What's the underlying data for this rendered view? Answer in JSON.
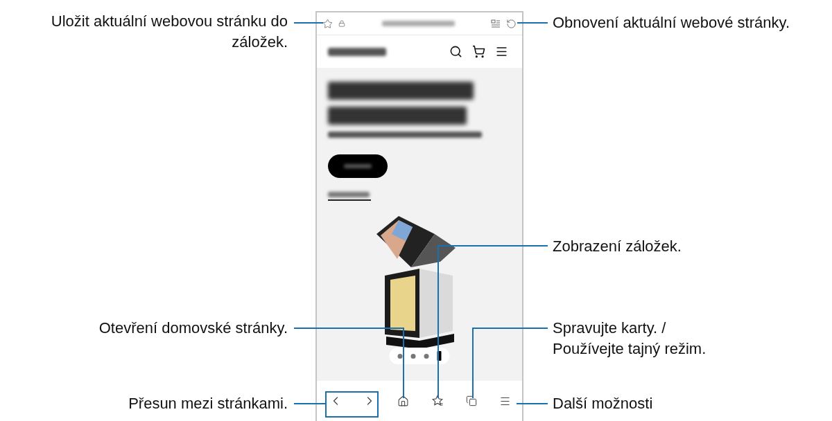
{
  "callouts": [
    {
      "text": "Uložit aktuální webovou stránku do záložek."
    },
    {
      "text": "Obnovení aktuální webové stránky."
    },
    {
      "text": "Zobrazení záložek."
    },
    {
      "text": "Otevření domovské stránky."
    },
    {
      "text": "Spravujte karty. / Používejte tajný režim."
    },
    {
      "text": "Přesun mezi stránkami."
    },
    {
      "text": "Další možnosti"
    }
  ],
  "carousel_pages": [
    {
      "selected": false
    },
    {
      "selected": false
    },
    {
      "selected": false
    },
    {
      "selected": true
    }
  ]
}
